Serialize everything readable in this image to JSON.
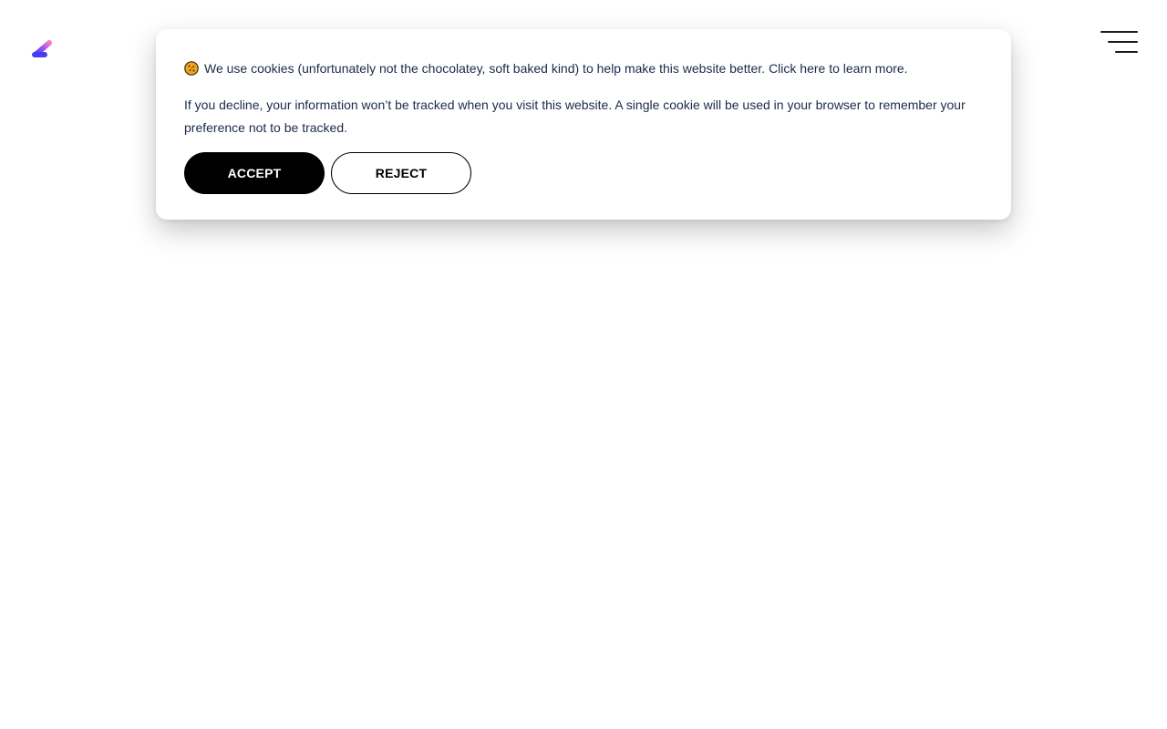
{
  "brand": {
    "logo_icon": "slash-logo-icon",
    "logo_colors": [
      "#4a3cf0",
      "#b066e8",
      "#ff7ac0"
    ]
  },
  "header": {
    "menu_icon": "hamburger-menu-icon"
  },
  "cookie_banner": {
    "icon": "cookie-icon",
    "message": "We use cookies (unfortunately not the chocolatey, soft baked kind) to help make this website better.",
    "learn_more_label": "Click here to learn more.",
    "decline_notice": "If you decline, your information won’t be tracked when you visit this website. A single cookie will be used in your browser to remember your preference not to be tracked.",
    "accept_label": "ACCEPT",
    "reject_label": "REJECT"
  },
  "colors": {
    "text": "#1b2a4a",
    "accept_bg": "#000000",
    "cookie_icon": "#f2a71b"
  }
}
